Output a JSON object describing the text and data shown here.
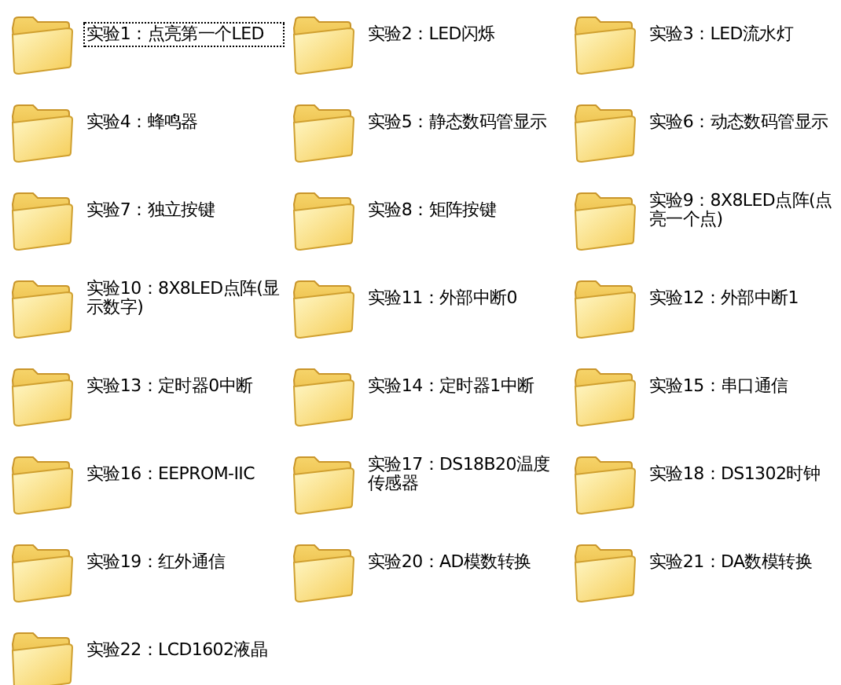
{
  "folders": [
    {
      "label": "实验1：点亮第一个LED",
      "focused": true
    },
    {
      "label": "实验2：LED闪烁",
      "focused": false
    },
    {
      "label": "实验3：LED流水灯",
      "focused": false
    },
    {
      "label": "实验4：蜂鸣器",
      "focused": false
    },
    {
      "label": "实验5：静态数码管显示",
      "focused": false
    },
    {
      "label": "实验6：动态数码管显示",
      "focused": false
    },
    {
      "label": "实验7：独立按键",
      "focused": false
    },
    {
      "label": "实验8：矩阵按键",
      "focused": false
    },
    {
      "label": "实验9：8X8LED点阵(点亮一个点)",
      "focused": false
    },
    {
      "label": "实验10：8X8LED点阵(显示数字)",
      "focused": false
    },
    {
      "label": "实验11：外部中断0",
      "focused": false
    },
    {
      "label": "实验12：外部中断1",
      "focused": false
    },
    {
      "label": "实验13：定时器0中断",
      "focused": false
    },
    {
      "label": "实验14：定时器1中断",
      "focused": false
    },
    {
      "label": "实验15：串口通信",
      "focused": false
    },
    {
      "label": "实验16：EEPROM-IIC",
      "focused": false
    },
    {
      "label": "实验17：DS18B20温度传感器",
      "focused": false
    },
    {
      "label": "实验18：DS1302时钟",
      "focused": false
    },
    {
      "label": "实验19：红外通信",
      "focused": false
    },
    {
      "label": "实验20：AD模数转换",
      "focused": false
    },
    {
      "label": "实验21：DA数模转换",
      "focused": false
    },
    {
      "label": "实验22：LCD1602液晶",
      "focused": false
    }
  ]
}
